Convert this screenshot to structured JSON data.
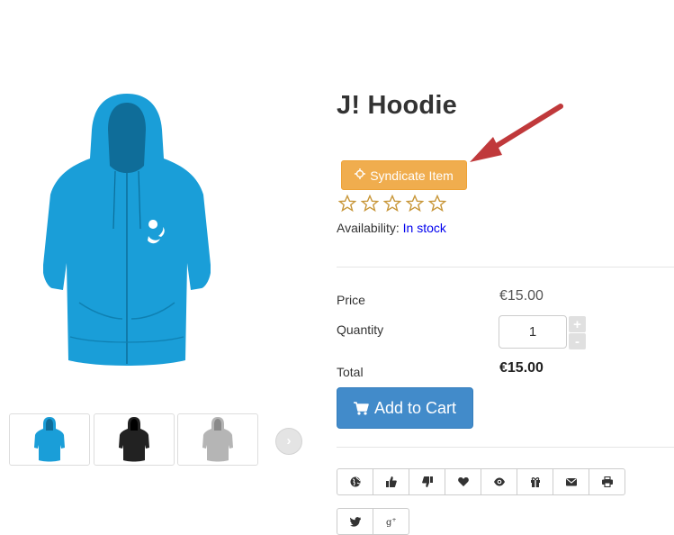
{
  "product": {
    "title": "J! Hoodie",
    "availability_label": "Availability:",
    "availability_value": "In stock",
    "rating": 0,
    "rating_max": 5,
    "image_color": "#1a9ed8"
  },
  "syndicate": {
    "label": "Syndicate Item",
    "icon": "crosshair-icon"
  },
  "thumbnails": [
    {
      "name": "blue-hoodie",
      "color": "#1a9ed8"
    },
    {
      "name": "black-hoodie",
      "color": "#222222"
    },
    {
      "name": "grey-hoodie",
      "color": "#b5b5b5"
    }
  ],
  "pricing": {
    "price_label": "Price",
    "price_value": "€15.00",
    "quantity_label": "Quantity",
    "quantity_value": "1",
    "plus": "+",
    "minus": "-",
    "total_label": "Total",
    "total_value": "€15.00"
  },
  "cart": {
    "label": "Add to Cart",
    "icon": "cart-icon"
  },
  "actions": [
    "globe-icon",
    "thumbs-up-icon",
    "thumbs-down-icon",
    "heart-icon",
    "eye-icon",
    "gift-icon",
    "envelope-icon",
    "print-icon"
  ],
  "social": [
    "twitter-icon",
    "google-plus-icon"
  ],
  "colors": {
    "syndicate_bg": "#f0ad4e",
    "cart_bg": "#428bca",
    "star_outline": "#c8973a",
    "link": "#0000ee"
  }
}
